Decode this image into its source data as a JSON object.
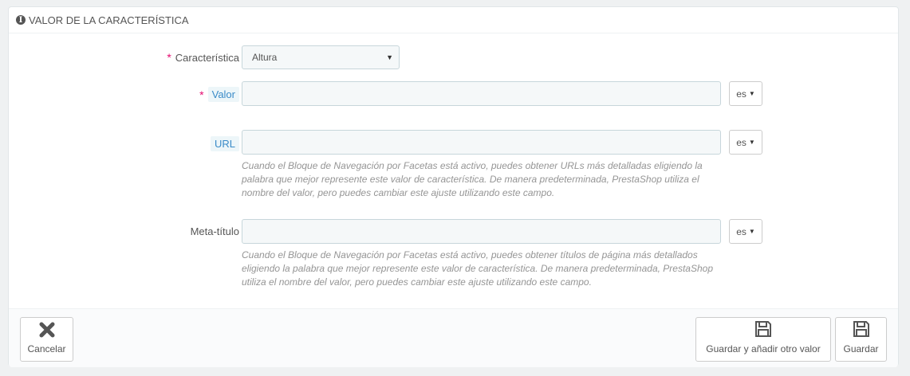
{
  "panel": {
    "title": "VALOR DE LA CARACTERÍSTICA",
    "icon": "info-icon"
  },
  "form": {
    "feature": {
      "label": "Característica",
      "required": "*",
      "selected": "Altura"
    },
    "value": {
      "label": "Valor",
      "required": "*",
      "input_value": "",
      "lang": "es"
    },
    "url": {
      "label": "URL",
      "input_value": "",
      "lang": "es",
      "help": "Cuando el Bloque de Navegación por Facetas está activo, puedes obtener URLs más detalladas eligiendo la palabra que mejor represente este valor de característica. De manera predeterminada, PrestaShop utiliza el nombre del valor, pero puedes cambiar este ajuste utilizando este campo."
    },
    "meta_title": {
      "label": "Meta-título",
      "input_value": "",
      "lang": "es",
      "help": "Cuando el Bloque de Navegación por Facetas está activo, puedes obtener títulos de página más detallados eligiendo la palabra que mejor represente este valor de característica. De manera predeterminada, PrestaShop utiliza el nombre del valor, pero puedes cambiar este ajuste utilizando este campo."
    }
  },
  "footer": {
    "cancel_label": "Cancelar",
    "save_and_add_label": "Guardar y añadir otro valor",
    "save_label": "Guardar"
  }
}
